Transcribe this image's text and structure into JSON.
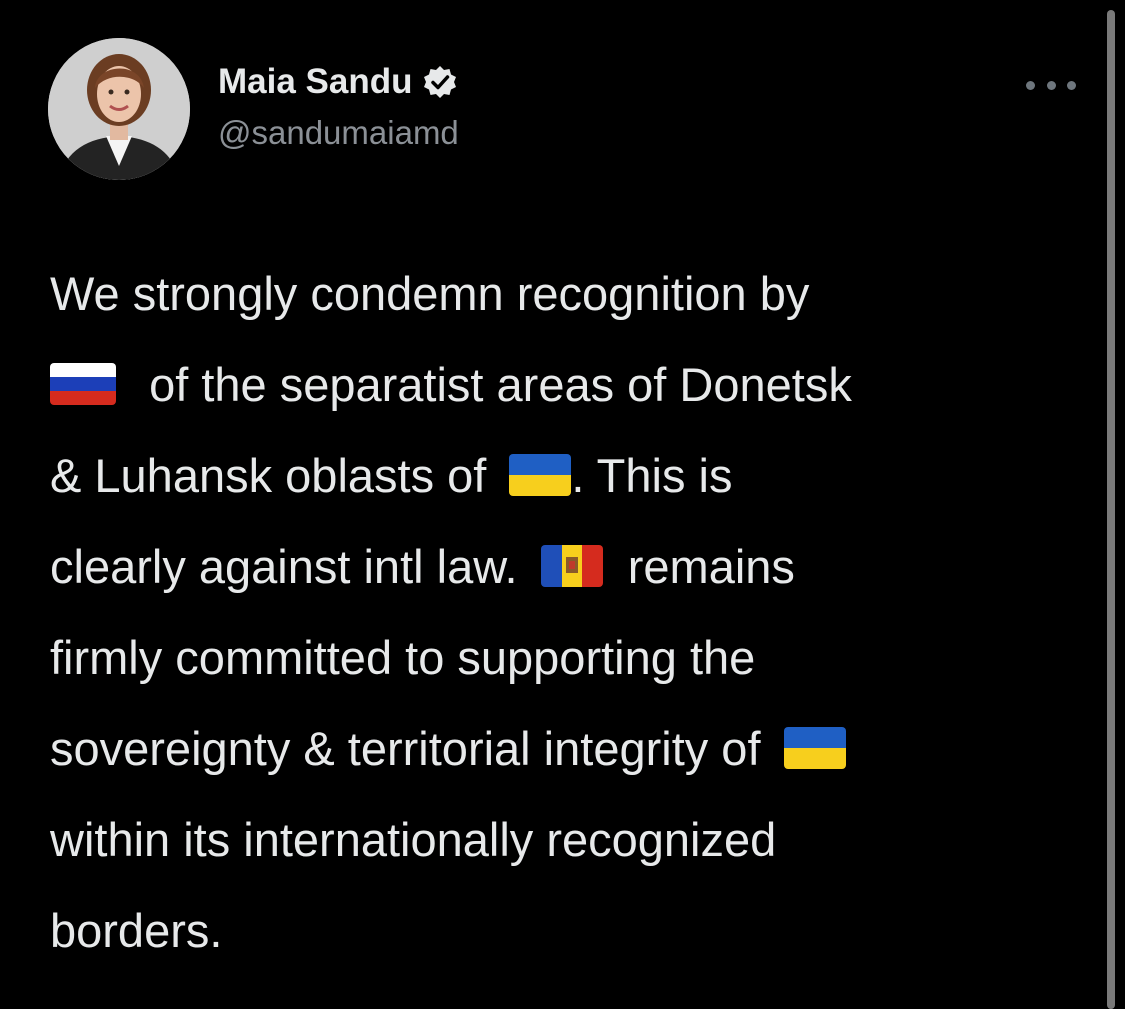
{
  "tweet": {
    "author": {
      "display_name": "Maia Sandu",
      "handle": "@sandumaiamd",
      "verified": true,
      "avatar": "profile-photo"
    },
    "more_icon": "more-horizontal-icon",
    "text": {
      "line1": "We strongly condemn recognition by",
      "line2_flag": "russia-flag",
      "line2": "of the separatist areas of Donetsk",
      "line3_a": "& Luhansk oblasts of",
      "line3_flag": "ukraine-flag",
      "line3_b": ". This is",
      "line4_a": "clearly against intl law.",
      "line4_flag": "moldova-flag",
      "line4_b": "remains",
      "line5": "firmly committed to supporting the",
      "line6_a": "sovereignty & territorial integrity of",
      "line6_flag": "ukraine-flag",
      "line7": "within its internationally recognized",
      "line8": "borders."
    }
  },
  "colors": {
    "background": "#000000",
    "text_primary": "#e7e9ea",
    "text_secondary": "#8b9096",
    "verified_badge": "#e7e9ea"
  }
}
